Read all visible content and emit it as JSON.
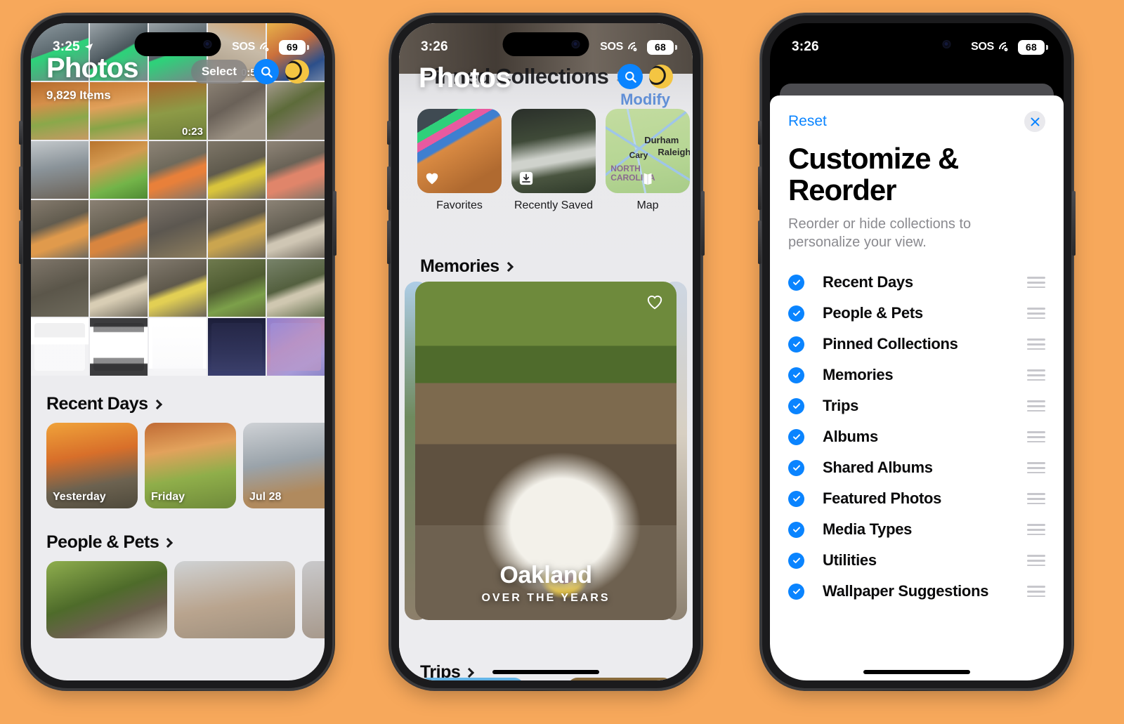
{
  "theme": {
    "background": "#f7a85b",
    "accent": "#0a84ff",
    "link": "#0a84ff"
  },
  "phone1": {
    "status": {
      "time": "3:25",
      "location_icon": "location-arrow-icon",
      "sos": "SOS",
      "wifi_icon": "wifi-icon",
      "battery": "69"
    },
    "header": {
      "title": "Photos",
      "item_count": "9,829 Items",
      "select_label": "Select",
      "search_icon": "search-icon",
      "avatar": "profile-avatar"
    },
    "grid": {
      "durations": {
        "r1c4": "0:51",
        "r2c3": "0:23"
      }
    },
    "recent_days": {
      "title": "Recent Days",
      "chevron": "chevron-right-icon",
      "cards": [
        {
          "label": "Yesterday"
        },
        {
          "label": "Friday"
        },
        {
          "label": "Jul 28"
        },
        {
          "label": ""
        }
      ]
    },
    "people_pets": {
      "title": "People & Pets",
      "chevron": "chevron-right-icon"
    }
  },
  "phone2": {
    "status": {
      "time": "3:26",
      "sos": "SOS",
      "wifi_icon": "wifi-icon",
      "battery": "68"
    },
    "header": {
      "title": "Photos",
      "search_icon": "search-icon",
      "avatar": "profile-avatar",
      "modify_label": "Modify"
    },
    "pinned": {
      "title": "Pinned Collections",
      "chevron": "chevron-right-icon",
      "items": [
        {
          "caption": "Favorites",
          "badge": "heart-icon"
        },
        {
          "caption": "Recently Saved",
          "badge": "download-icon"
        },
        {
          "caption": "Map",
          "badge": "map-pin-icon",
          "places": [
            "Durham",
            "Raleigh",
            "Cary",
            "NORTH CAROLINA"
          ]
        }
      ]
    },
    "memories": {
      "title": "Memories",
      "chevron": "chevron-right-icon",
      "card": {
        "title": "Oakland",
        "subtitle": "OVER THE YEARS",
        "favorite_icon": "heart-outline-icon"
      }
    },
    "trips": {
      "title": "Trips",
      "chevron": "chevron-right-icon"
    }
  },
  "phone3": {
    "status": {
      "time": "3:26",
      "sos": "SOS",
      "wifi_icon": "wifi-icon",
      "battery": "68"
    },
    "sheet": {
      "reset_label": "Reset",
      "close_icon": "close-icon",
      "title": "Customize & Reorder",
      "description": "Reorder or hide collections to personalize your view.",
      "items": [
        {
          "label": "Recent Days",
          "checked": true,
          "handle": "drag-handle-icon"
        },
        {
          "label": "People & Pets",
          "checked": true,
          "handle": "drag-handle-icon"
        },
        {
          "label": "Pinned Collections",
          "checked": true,
          "handle": "drag-handle-icon"
        },
        {
          "label": "Memories",
          "checked": true,
          "handle": "drag-handle-icon"
        },
        {
          "label": "Trips",
          "checked": true,
          "handle": "drag-handle-icon"
        },
        {
          "label": "Albums",
          "checked": true,
          "handle": "drag-handle-icon"
        },
        {
          "label": "Shared Albums",
          "checked": true,
          "handle": "drag-handle-icon"
        },
        {
          "label": "Featured Photos",
          "checked": true,
          "handle": "drag-handle-icon"
        },
        {
          "label": "Media Types",
          "checked": true,
          "handle": "drag-handle-icon"
        },
        {
          "label": "Utilities",
          "checked": true,
          "handle": "drag-handle-icon"
        },
        {
          "label": "Wallpaper Suggestions",
          "checked": true,
          "handle": "drag-handle-icon"
        }
      ]
    }
  }
}
